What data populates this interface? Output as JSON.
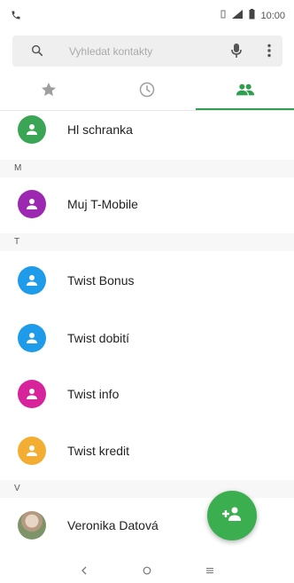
{
  "status_bar": {
    "time": "10:00"
  },
  "search": {
    "placeholder": "Vyhledat kontakty"
  },
  "tabs": [
    {
      "name": "favorites",
      "icon": "star-icon"
    },
    {
      "name": "recents",
      "icon": "clock-icon"
    },
    {
      "name": "contacts",
      "icon": "people-icon",
      "active": true
    }
  ],
  "contacts": {
    "hl_schranka": "Hl schranka",
    "section_m": "M",
    "muj_tmobile": "Muj T-Mobile",
    "section_t": "T",
    "twist_bonus": "Twist Bonus",
    "twist_dobiti": "Twist dobití",
    "twist_info": "Twist info",
    "twist_kredit": "Twist kredit",
    "section_v": "V",
    "veronika": "Veronika Datová"
  },
  "colors": {
    "accent": "#2e9e4f",
    "green_avatar": "#3aa655",
    "purple_avatar": "#9c27b0",
    "blue_avatar": "#1e9be9",
    "pink_avatar": "#d8249b",
    "orange_avatar": "#f4ad33",
    "fab": "#3bae4f"
  }
}
